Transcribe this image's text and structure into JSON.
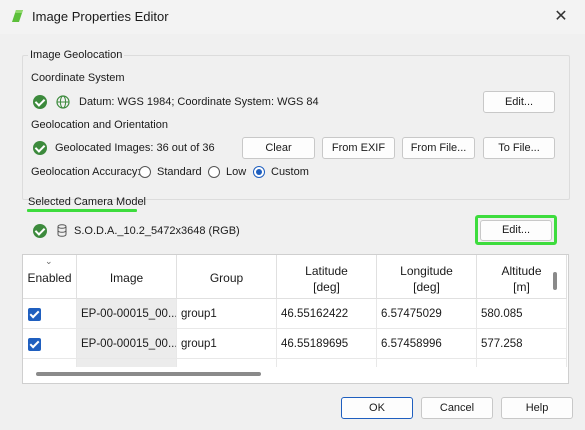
{
  "window": {
    "title": "Image Properties Editor",
    "close_glyph": "✕"
  },
  "geolocation": {
    "group_title": "Image Geolocation",
    "coordinate_system": {
      "heading": "Coordinate System",
      "value": "Datum: WGS 1984; Coordinate System: WGS 84",
      "edit_label": "Edit..."
    },
    "orientation": {
      "heading": "Geolocation and Orientation",
      "status": "Geolocated Images: 36 out of 36",
      "buttons": [
        "Clear",
        "From EXIF",
        "From File...",
        "To File..."
      ]
    },
    "accuracy": {
      "label": "Geolocation Accuracy:",
      "options": [
        "Standard",
        "Low",
        "Custom"
      ],
      "selected": "Custom"
    }
  },
  "camera": {
    "heading": "Selected Camera Model",
    "value": "S.O.D.A._10.2_5472x3648 (RGB)",
    "edit_label": "Edit..."
  },
  "table": {
    "columns": [
      {
        "l1": "Enabled",
        "l2": ""
      },
      {
        "l1": "Image",
        "l2": ""
      },
      {
        "l1": "Group",
        "l2": ""
      },
      {
        "l1": "Latitude",
        "l2": "[deg]"
      },
      {
        "l1": "Longitude",
        "l2": "[deg]"
      },
      {
        "l1": "Altitude",
        "l2": "[m]"
      }
    ],
    "rows": [
      {
        "enabled": true,
        "image": "EP-00-00015_00...",
        "group": "group1",
        "latitude": "46.55162422",
        "longitude": "6.57475029",
        "altitude": "580.085"
      },
      {
        "enabled": true,
        "image": "EP-00-00015_00...",
        "group": "group1",
        "latitude": "46.55189695",
        "longitude": "6.57458996",
        "altitude": "577.258"
      }
    ]
  },
  "footer": {
    "ok": "OK",
    "cancel": "Cancel",
    "help": "Help"
  },
  "colors": {
    "accent": "#1f5fbf",
    "status_ok": "#3c8a3c",
    "highlight": "#3ddc3d"
  }
}
